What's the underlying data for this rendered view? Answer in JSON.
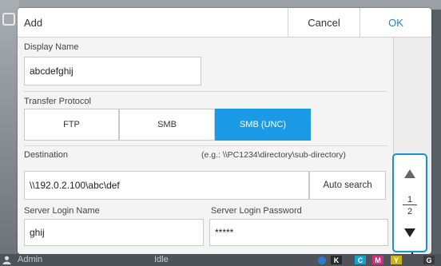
{
  "dialog": {
    "title": "Add",
    "cancel_label": "Cancel",
    "ok_label": "OK"
  },
  "display_name": {
    "label": "Display Name",
    "value": "abcdefghij"
  },
  "transfer_protocol": {
    "label": "Transfer Protocol",
    "options": [
      "FTP",
      "SMB",
      "SMB (UNC)"
    ],
    "selected": "SMB (UNC)"
  },
  "destination": {
    "label": "Destination",
    "hint": "(e.g.: \\\\PC1234\\directory\\sub-directory)",
    "value": "\\\\192.0.2.100\\abc\\def",
    "auto_search_label": "Auto search"
  },
  "server_login": {
    "name_label": "Server Login Name",
    "name_value": "ghij",
    "password_label": "Server Login Password",
    "password_value": "*****"
  },
  "pager": {
    "current": "1",
    "total": "2"
  },
  "status_bar": {
    "user": "Admin",
    "state": "Idle",
    "inks": [
      "K",
      "C",
      "M",
      "Y",
      "G"
    ]
  },
  "colors": {
    "accent": "#1b9ae6",
    "ok_text": "#1f7fd8"
  }
}
